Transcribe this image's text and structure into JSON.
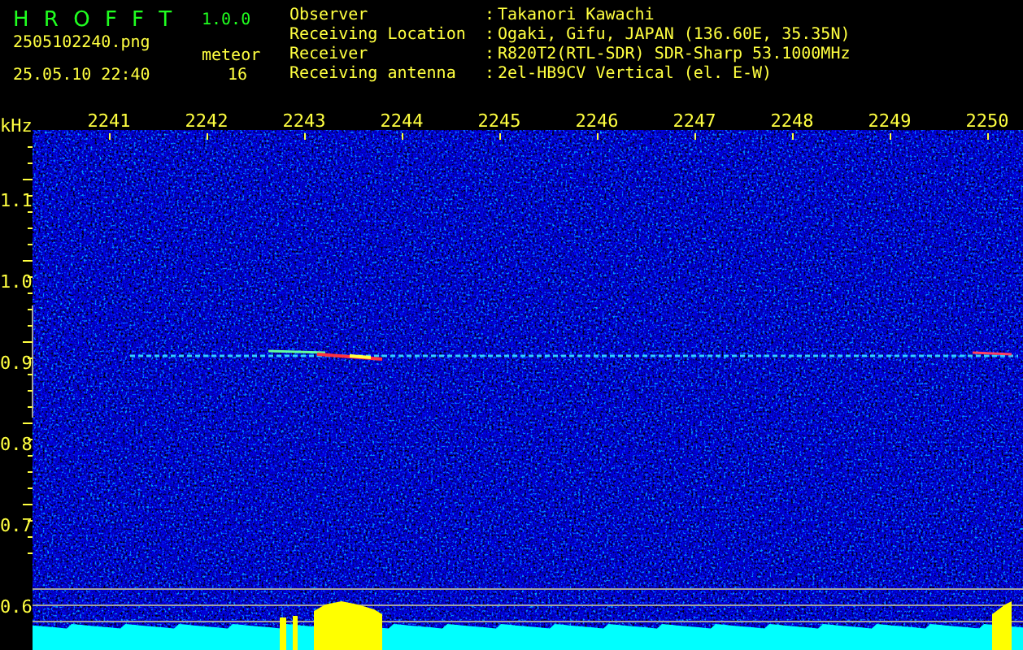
{
  "header": {
    "app_title": "H R O F F T",
    "version": "1.0.0",
    "file_name": "2505102240.png",
    "timestamp": "25.05.10 22:40",
    "detection_label": "meteor",
    "detection_count": "16"
  },
  "station": [
    {
      "label": "Observer",
      "separator": ":",
      "value": "Takanori Kawachi"
    },
    {
      "label": "Receiving Location",
      "separator": ":",
      "value": "Ogaki, Gifu, JAPAN (136.60E, 35.35N)"
    },
    {
      "label": "Receiver",
      "separator": ":",
      "value": "R820T2(RTL-SDR) SDR-Sharp 53.1000MHz"
    },
    {
      "label": "Receiving antenna",
      "separator": ":",
      "value": "2el-HB9CV Vertical (el. E-W)"
    }
  ],
  "spectrogram": {
    "unit": "kHz",
    "x_labels": [
      "2241",
      "2242",
      "2243",
      "2244",
      "2245",
      "2246",
      "2247",
      "2248",
      "2249",
      "2250"
    ],
    "y_labels": [
      "1.1",
      "1.0",
      "0.9",
      "0.8",
      "0.7",
      "0.6"
    ]
  }
}
